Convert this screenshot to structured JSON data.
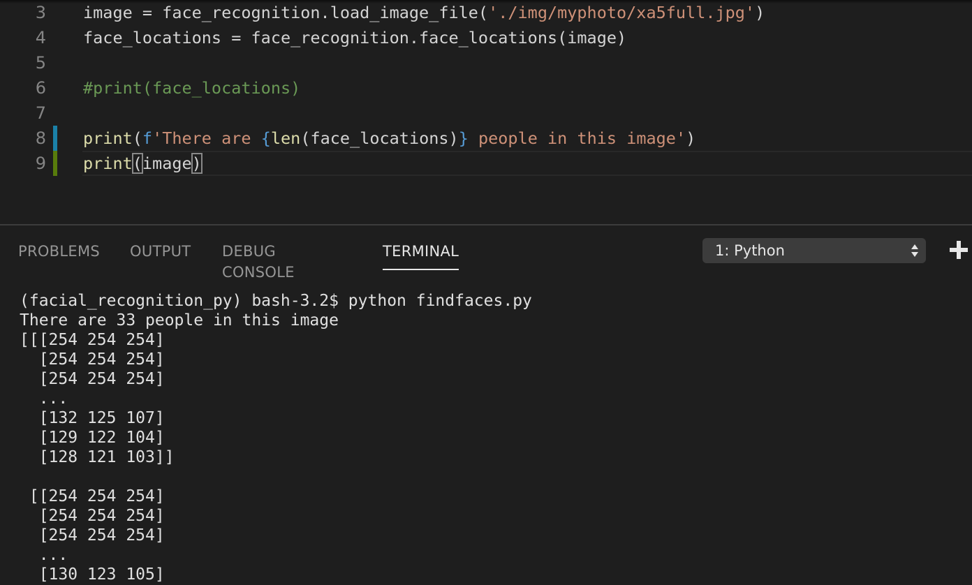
{
  "editor": {
    "lines": [
      {
        "number": "3",
        "segments": [
          {
            "text": "image = face_recognition.load_image_file(",
            "color": "#d4d4d4"
          },
          {
            "text": "'./img/myphoto/xa5full.jpg'",
            "color": "#ce9178"
          },
          {
            "text": ")",
            "color": "#d4d4d4"
          }
        ]
      },
      {
        "number": "4",
        "segments": [
          {
            "text": "face_locations = face_recognition.face_locations(image)",
            "color": "#d4d4d4"
          }
        ]
      },
      {
        "number": "5",
        "segments": []
      },
      {
        "number": "6",
        "segments": [
          {
            "text": "#print(face_locations)",
            "color": "#6a9955"
          }
        ]
      },
      {
        "number": "7",
        "segments": []
      },
      {
        "number": "8",
        "gutter": "modified",
        "segments": [
          {
            "text": "print",
            "color": "#dcdcaa"
          },
          {
            "text": "(",
            "color": "#d4d4d4"
          },
          {
            "text": "f",
            "color": "#569cd6"
          },
          {
            "text": "'There are ",
            "color": "#ce9178"
          },
          {
            "text": "{",
            "color": "#569cd6"
          },
          {
            "text": "len",
            "color": "#dcdcaa"
          },
          {
            "text": "(face_locations)",
            "color": "#d4d4d4"
          },
          {
            "text": "}",
            "color": "#569cd6"
          },
          {
            "text": " people in this image'",
            "color": "#ce9178"
          },
          {
            "text": ")",
            "color": "#d4d4d4"
          }
        ]
      },
      {
        "number": "9",
        "gutter": "added",
        "current": true,
        "segments": [
          {
            "text": "print",
            "color": "#dcdcaa"
          },
          {
            "text": "(",
            "color": "#d4d4d4",
            "bracket": true
          },
          {
            "text": "image",
            "color": "#d4d4d4"
          },
          {
            "text": ")",
            "color": "#d4d4d4",
            "bracket": true
          }
        ]
      }
    ],
    "gutter_colors": {
      "modified": "#1b81a8",
      "added": "#587c0c"
    }
  },
  "panel": {
    "tabs": [
      {
        "label": "PROBLEMS",
        "active": false
      },
      {
        "label": "OUTPUT",
        "active": false
      },
      {
        "label": "DEBUG CONSOLE",
        "active": false
      },
      {
        "label": "TERMINAL",
        "active": true
      }
    ],
    "terminal_select": {
      "value": "1: Python"
    },
    "add_icon": "plus-icon",
    "terminal_lines": [
      "(facial_recognition_py) bash-3.2$ python findfaces.py",
      "There are 33 people in this image",
      "[[[254 254 254]",
      "  [254 254 254]",
      "  [254 254 254]",
      "  ...",
      "  [132 125 107]",
      "  [129 122 104]",
      "  [128 121 103]]",
      "",
      " [[254 254 254]",
      "  [254 254 254]",
      "  [254 254 254]",
      "  ...",
      "  [130 123 105]"
    ]
  }
}
